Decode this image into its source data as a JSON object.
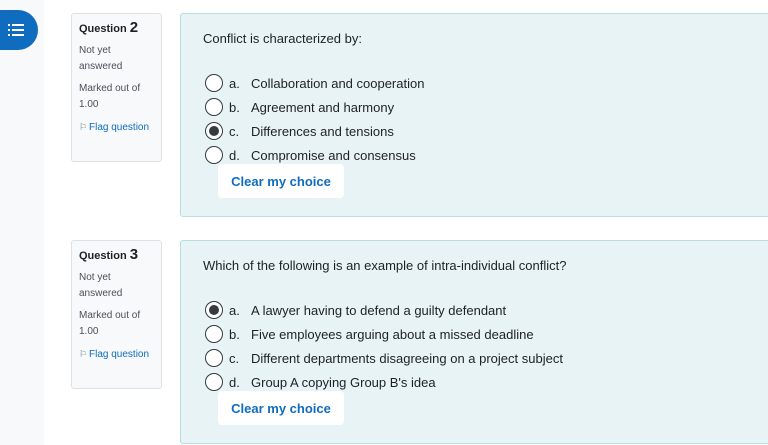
{
  "nav": {
    "menu_icon": "list-icon"
  },
  "questions": [
    {
      "label": "Question",
      "number": "2",
      "state": "Not yet answered",
      "grade": "Marked out of 1.00",
      "flag": "Flag question",
      "text": "Conflict is characterized by:",
      "answers": [
        {
          "letter": "a.",
          "text": "Collaboration and cooperation",
          "checked": false
        },
        {
          "letter": "b.",
          "text": "Agreement and harmony",
          "checked": false
        },
        {
          "letter": "c.",
          "text": "Differences and tensions",
          "checked": true
        },
        {
          "letter": "d.",
          "text": "Compromise and consensus",
          "checked": false
        }
      ],
      "clear_label": "Clear my choice"
    },
    {
      "label": "Question",
      "number": "3",
      "state": "Not yet answered",
      "grade": "Marked out of 1.00",
      "flag": "Flag question",
      "text": "Which of the following is an example of intra-individual conflict?",
      "answers": [
        {
          "letter": "a.",
          "text": "A lawyer having to defend a guilty defendant",
          "checked": true
        },
        {
          "letter": "b.",
          "text": "Five employees arguing about a missed deadline",
          "checked": false
        },
        {
          "letter": "c.",
          "text": "Different departments disagreeing on a project subject",
          "checked": false
        },
        {
          "letter": "d.",
          "text": "Group A copying Group B's idea",
          "checked": false
        }
      ],
      "clear_label": "Clear my choice"
    }
  ],
  "colors": {
    "accent": "#0f6cbf",
    "formulation_bg": "#e7f3f5"
  }
}
